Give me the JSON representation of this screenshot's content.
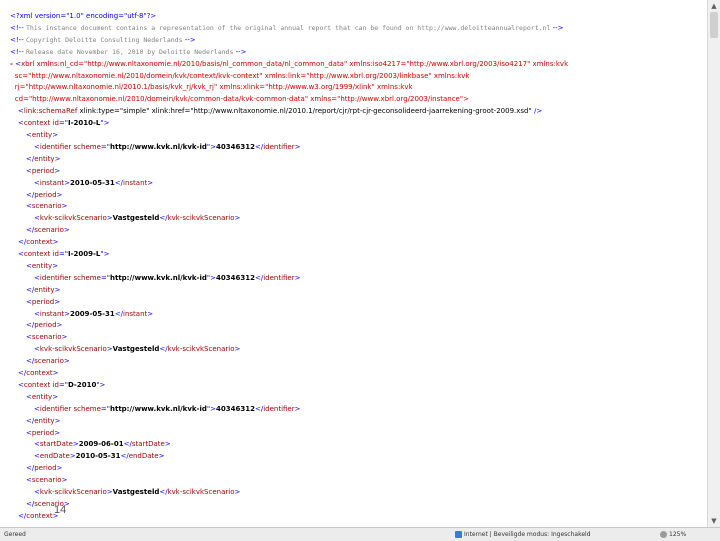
{
  "xml": {
    "declaration": "<?xml version=\"1.0\" encoding=\"utf-8\"?>",
    "comments": [
      "This instance document contains a representation of the original annual report that can be found on http://www.deloitteannualreport.nl",
      "Copyright Deloitte Consulting Nederlands",
      "Release date November 16, 2010 by Deloitte Nederlands"
    ],
    "root": {
      "open_lines": [
        {
          "marker": "-",
          "text_name": "xbrl",
          "attrs": "xmlns:nl_cd=\"http://www.nltaxonomie.nl/2010/basis/nl_common_data/nl_common_data\" xmlns:iso4217=\"http://www.xbrl.org/2003/iso4217\" xmlns:kvk"
        },
        {
          "text": "sc=\"http://www.nltaxonomie.nl/2010/domein/kvk/context/kvk-context\" xmlns:link=\"http://www.xbrl.org/2003/linkbase\" xmlns:kvk"
        },
        {
          "text": "rj=\"http://www.nltaxonomie.nl/2010.1/basis/kvk_rj/kvk_rj\" xmlns:xlink=\"http://www.w3.org/1999/xlink\" xmlns:kvk"
        },
        {
          "text": "cd=\"http://www.nltaxonomie.nl/2010/domein/kvk/common-data/kvk-common-data\" xmlns=\"http://www.xbrl.org/2003/instance\">"
        }
      ],
      "schema_ref": "<link:schemaRef xlink:type=\"simple\" xlink:href=\"http://www.nltaxonomie.nl/2010.1/report/cjr/rpt-cjr-geconsolideerd-jaarrekening-groot-2009.xsd\" />"
    },
    "contexts": [
      {
        "id": "I-2010-L",
        "identifier": "40346312",
        "scheme": "http://www.kvk.nl/kvk-id",
        "period_type": "instant",
        "instant": "2010-05-31",
        "scenario": "Vastgesteld"
      },
      {
        "id": "I-2009-L",
        "identifier": "40346312",
        "scheme": "http://www.kvk.nl/kvk-id",
        "period_type": "instant",
        "instant": "2009-05-31",
        "scenario": "Vastgesteld"
      },
      {
        "id": "D-2010",
        "identifier": "40346312",
        "scheme": "http://www.kvk.nl/kvk-id",
        "period_type": "duration",
        "startDate": "2009-06-01",
        "endDate": "2010-05-31",
        "scenario": "Vastgesteld"
      }
    ]
  },
  "page_number": "14",
  "statusbar": {
    "left": "Gereed",
    "zone": "Internet | Beveiligde modus: Ingeschakeld",
    "zoom": "125%"
  }
}
